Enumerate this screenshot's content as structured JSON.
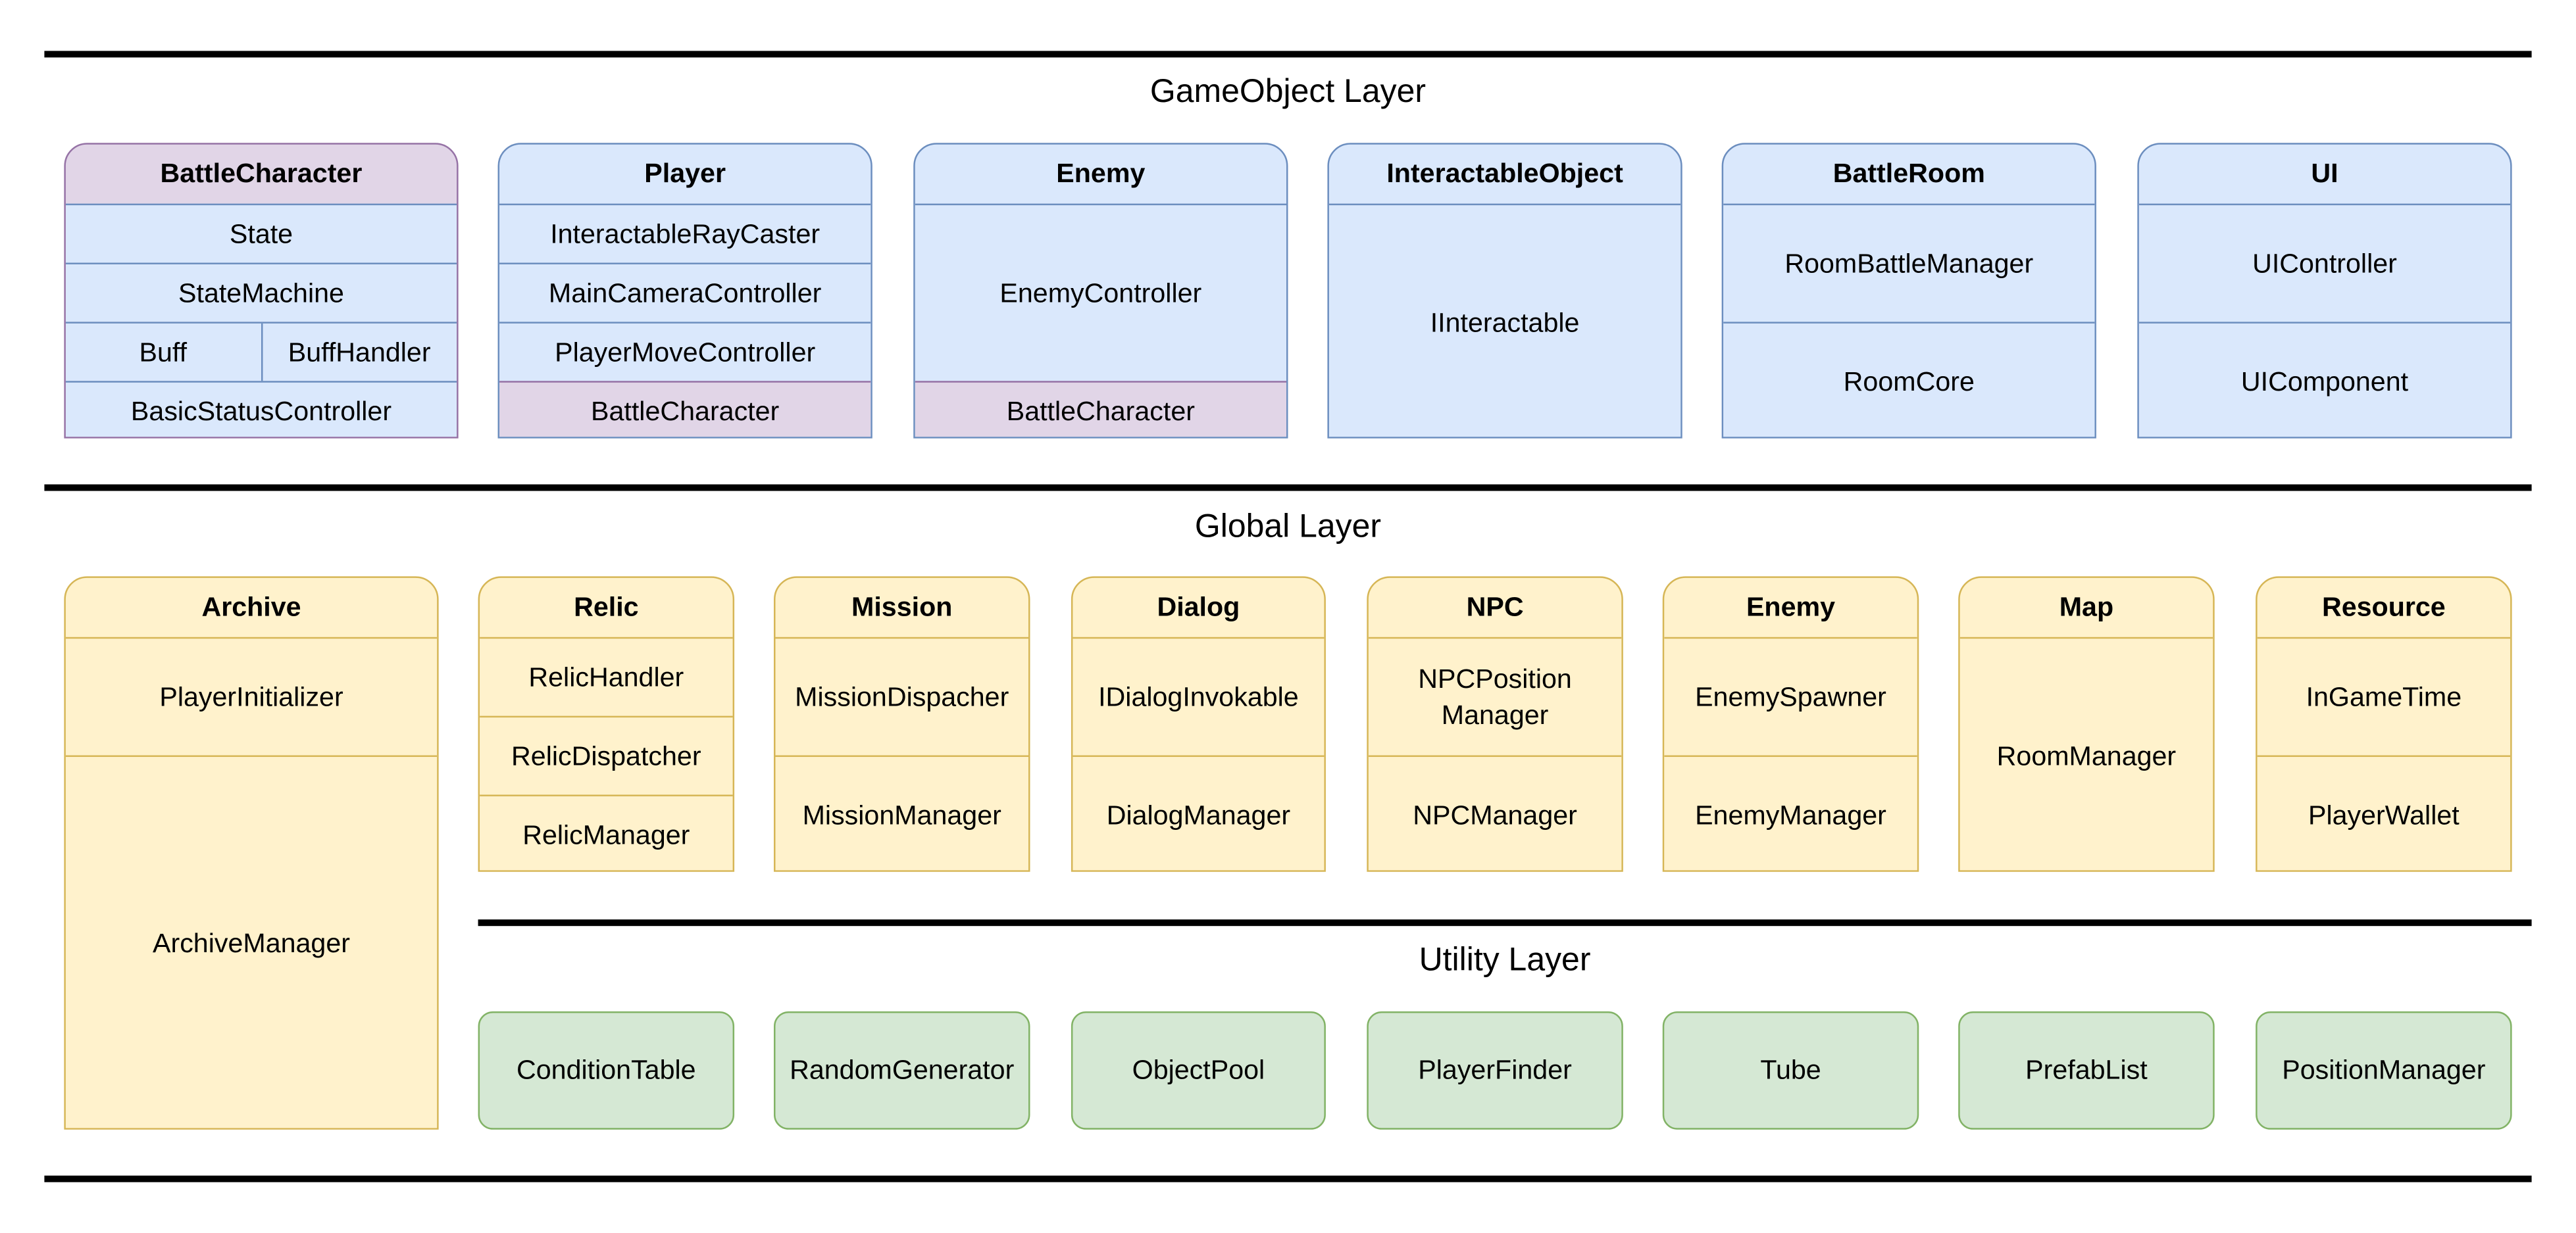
{
  "colors": {
    "blue": {
      "fill": "#dae8fc",
      "stroke": "#6c8ebf"
    },
    "purple": {
      "fill": "#e1d5e7",
      "stroke": "#9673a6"
    },
    "yellow": {
      "fill": "#fff2cc",
      "stroke": "#d6b656"
    },
    "green": {
      "fill": "#d5e8d4",
      "stroke": "#82b366"
    }
  },
  "layers": {
    "gameobject": {
      "title": "GameObject Layer",
      "boxes": [
        {
          "name": "BattleCharacter",
          "color": "purple",
          "rows": [
            {
              "cells": [
                "State"
              ],
              "color": "blue"
            },
            {
              "cells": [
                "StateMachine"
              ],
              "color": "blue"
            },
            {
              "cells": [
                "Buff",
                "BuffHandler"
              ],
              "color": "blue"
            },
            {
              "cells": [
                "BasicStatusController"
              ],
              "color": "blue"
            }
          ]
        },
        {
          "name": "Player",
          "color": "blue",
          "rows": [
            {
              "cells": [
                "InteractableRayCaster"
              ],
              "color": "blue"
            },
            {
              "cells": [
                "MainCameraController"
              ],
              "color": "blue"
            },
            {
              "cells": [
                "PlayerMoveController"
              ],
              "color": "blue"
            },
            {
              "cells": [
                "BattleCharacter"
              ],
              "color": "purple"
            }
          ]
        },
        {
          "name": "Enemy",
          "color": "blue",
          "rows": [
            {
              "cells": [
                "EnemyController"
              ],
              "color": "blue"
            },
            {
              "cells": [
                "BattleCharacter"
              ],
              "color": "purple"
            }
          ]
        },
        {
          "name": "InteractableObject",
          "color": "blue",
          "rows": [
            {
              "cells": [
                "IInteractable"
              ],
              "color": "blue"
            }
          ]
        },
        {
          "name": "BattleRoom",
          "color": "blue",
          "rows": [
            {
              "cells": [
                "RoomBattleManager"
              ],
              "color": "blue"
            },
            {
              "cells": [
                "RoomCore"
              ],
              "color": "blue"
            }
          ]
        },
        {
          "name": "UI",
          "color": "blue",
          "rows": [
            {
              "cells": [
                "UIController"
              ],
              "color": "blue"
            },
            {
              "cells": [
                "UIComponent"
              ],
              "color": "blue"
            }
          ]
        }
      ]
    },
    "global": {
      "title": "Global Layer",
      "boxes": [
        {
          "name": "Archive",
          "color": "yellow",
          "rows": [
            {
              "cells": [
                "PlayerInitializer"
              ]
            },
            {
              "cells": [
                "ArchiveManager"
              ]
            }
          ]
        },
        {
          "name": "Relic",
          "color": "yellow",
          "rows": [
            {
              "cells": [
                "RelicHandler"
              ]
            },
            {
              "cells": [
                "RelicDispatcher"
              ]
            },
            {
              "cells": [
                "RelicManager"
              ]
            }
          ]
        },
        {
          "name": "Mission",
          "color": "yellow",
          "rows": [
            {
              "cells": [
                "MissionDispacher"
              ]
            },
            {
              "cells": [
                "MissionManager"
              ]
            }
          ]
        },
        {
          "name": "Dialog",
          "color": "yellow",
          "rows": [
            {
              "cells": [
                "IDialogInvokable"
              ]
            },
            {
              "cells": [
                "DialogManager"
              ]
            }
          ]
        },
        {
          "name": "NPC",
          "color": "yellow",
          "rows": [
            {
              "cells": [
                "NPCPosition Manager"
              ]
            },
            {
              "cells": [
                "NPCManager"
              ]
            }
          ]
        },
        {
          "name": "Enemy",
          "color": "yellow",
          "rows": [
            {
              "cells": [
                "EnemySpawner"
              ]
            },
            {
              "cells": [
                "EnemyManager"
              ]
            }
          ]
        },
        {
          "name": "Map",
          "color": "yellow",
          "rows": [
            {
              "cells": [
                "RoomManager"
              ]
            }
          ]
        },
        {
          "name": "Resource",
          "color": "yellow",
          "rows": [
            {
              "cells": [
                "InGameTime"
              ]
            },
            {
              "cells": [
                "PlayerWallet"
              ]
            }
          ]
        }
      ]
    },
    "utility": {
      "title": "Utility Layer",
      "color": "green",
      "items": [
        "ConditionTable",
        "RandomGenerator",
        "ObjectPool",
        "PlayerFinder",
        "Tube",
        "PrefabList",
        "PositionManager"
      ]
    }
  }
}
